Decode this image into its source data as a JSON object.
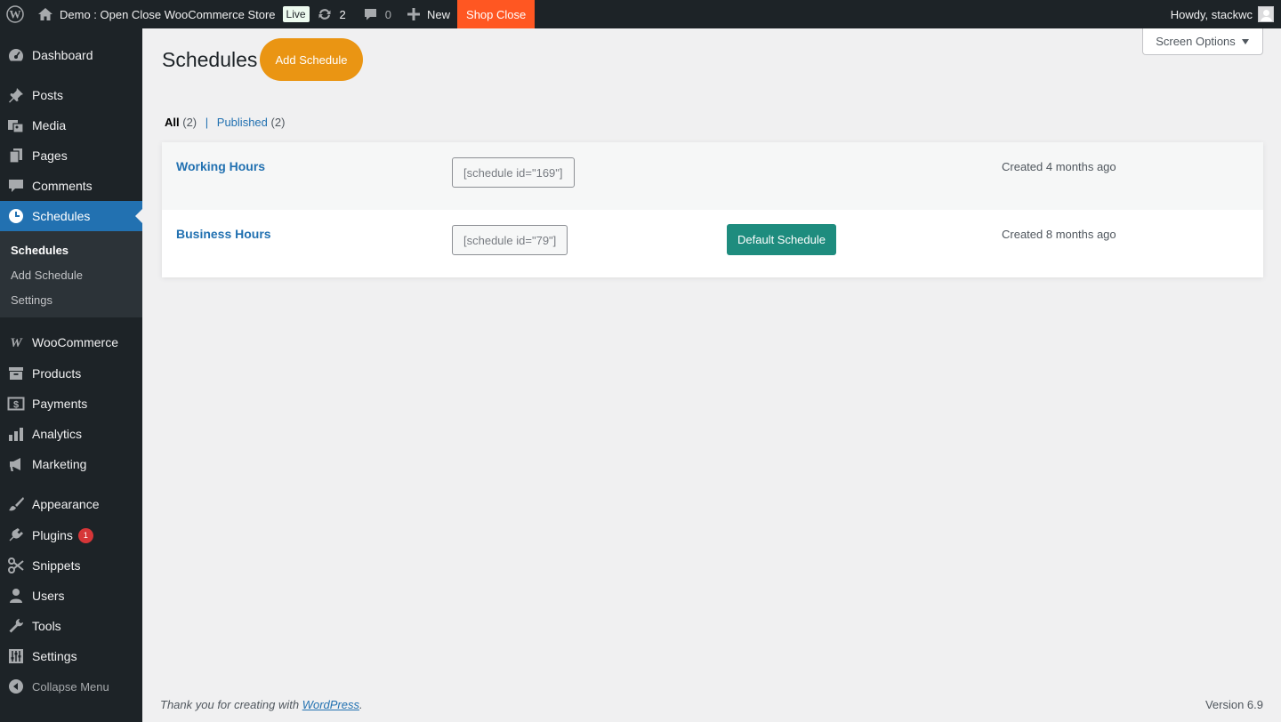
{
  "adminbar": {
    "site_name": "Demo : Open Close WooCommerce Store",
    "live_badge": "Live",
    "updates_count": "2",
    "comments_count": "0",
    "new_label": "New",
    "shop_status": "Shop Close",
    "greeting": "Howdy, stackwc"
  },
  "sidebar": {
    "items": [
      {
        "label": "Dashboard",
        "icon": "dashboard-icon"
      },
      {
        "label": "Posts",
        "icon": "pin-icon"
      },
      {
        "label": "Media",
        "icon": "media-icon"
      },
      {
        "label": "Pages",
        "icon": "pages-icon"
      },
      {
        "label": "Comments",
        "icon": "comment-icon"
      },
      {
        "label": "Schedules",
        "icon": "clock-icon"
      },
      {
        "label": "WooCommerce",
        "icon": "woocommerce-icon"
      },
      {
        "label": "Products",
        "icon": "archive-icon"
      },
      {
        "label": "Payments",
        "icon": "dollar-icon"
      },
      {
        "label": "Analytics",
        "icon": "bar-chart-icon"
      },
      {
        "label": "Marketing",
        "icon": "megaphone-icon"
      },
      {
        "label": "Appearance",
        "icon": "brush-icon"
      },
      {
        "label": "Plugins",
        "icon": "plug-icon"
      },
      {
        "label": "Snippets",
        "icon": "scissors-icon"
      },
      {
        "label": "Users",
        "icon": "user-icon"
      },
      {
        "label": "Tools",
        "icon": "wrench-icon"
      },
      {
        "label": "Settings",
        "icon": "sliders-icon"
      }
    ],
    "plugins_badge": "1",
    "submenu": [
      "Schedules",
      "Add Schedule",
      "Settings"
    ],
    "collapse_label": "Collapse Menu"
  },
  "main": {
    "title": "Schedules",
    "add_button": "Add Schedule",
    "screen_options": "Screen Options",
    "filters": {
      "all_label": "All",
      "all_count": "(2)",
      "separator": "|",
      "published_label": "Published",
      "published_count": "(2)"
    },
    "rows": [
      {
        "title": "Working Hours",
        "shortcode": "[schedule id=\"169\"]",
        "default": "",
        "created": "Created 4 months ago"
      },
      {
        "title": "Business Hours",
        "shortcode": "[schedule id=\"79\"]",
        "default": "Default Schedule",
        "created": "Created 8 months ago"
      }
    ]
  },
  "footer": {
    "thanks_prefix": "Thank you for creating with ",
    "thanks_link": "WordPress",
    "thanks_suffix": ".",
    "version": "Version 6.9"
  },
  "colors": {
    "admin_dark": "#1d2327",
    "accent_blue": "#2271b1",
    "shop_close": "#ff5722",
    "add_button": "#ea9513",
    "default_badge": "#1e8c7e"
  }
}
